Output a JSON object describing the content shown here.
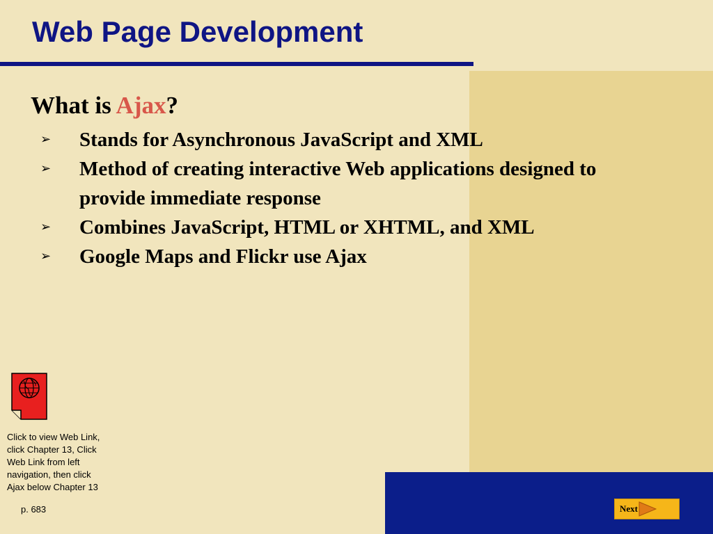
{
  "slide": {
    "title": "Web Page Development",
    "question_prefix": "What is ",
    "question_highlight": "Ajax",
    "question_suffix": "?",
    "bullets": [
      "Stands for Asynchronous JavaScript and XML",
      "Method of creating interactive Web applications designed to provide immediate response",
      "Combines JavaScript, HTML or XHTML, and XML",
      "Google Maps and Flickr use Ajax"
    ],
    "bullet_glyph": "➢"
  },
  "weblink": {
    "icon": "globe-page-icon",
    "caption": "Click to view Web Link,\nclick Chapter 13, Click\nWeb Link from left\nnavigation,  then click\nAjax below Chapter 13"
  },
  "footer": {
    "page_ref": "p. 683",
    "next_label": "Next"
  },
  "colors": {
    "background": "#f1e5bd",
    "panel": "#e8d492",
    "title": "#0f1584",
    "highlight": "#d8574a",
    "bottom_bar": "#0b1e8a",
    "button": "#f6b619",
    "icon_red": "#e8201f"
  }
}
